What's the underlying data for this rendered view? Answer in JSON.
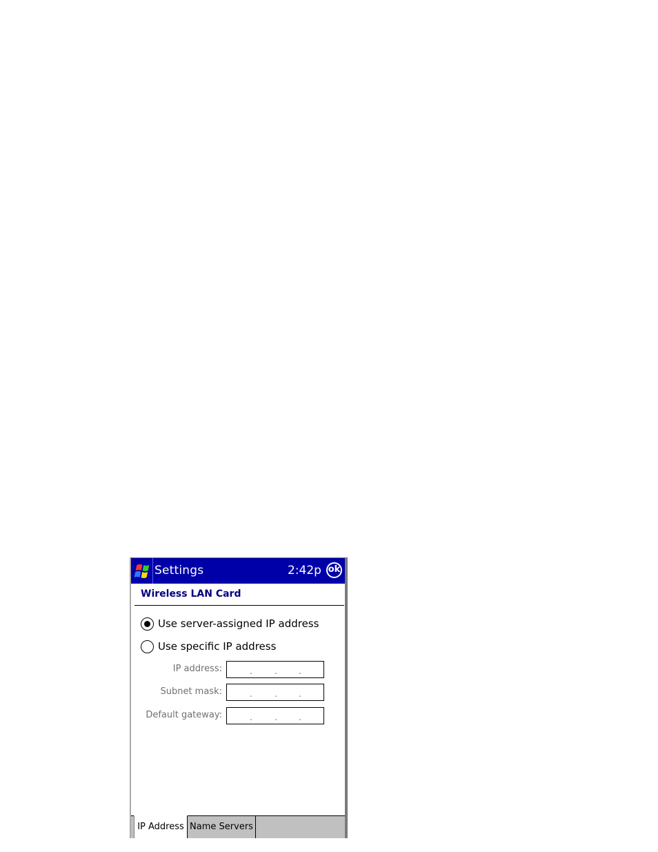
{
  "titlebar": {
    "title": "Settings",
    "time": "2:42p",
    "ok_label": "ok",
    "start_icon": "windows-flag-icon",
    "background": "#0000a8"
  },
  "page": {
    "section_title": "Wireless LAN Card",
    "section_color": "#000080"
  },
  "options": [
    {
      "label": "Use server-assigned IP address",
      "checked": true
    },
    {
      "label": "Use specific IP address",
      "checked": false
    }
  ],
  "fields": [
    {
      "label": "IP address:",
      "value": ". . ."
    },
    {
      "label": "Subnet mask:",
      "value": ". . ."
    },
    {
      "label": "Default gateway:",
      "value": ". . ."
    }
  ],
  "tabs": [
    {
      "label": "IP Address",
      "active": true
    },
    {
      "label": "Name Servers",
      "active": false
    }
  ]
}
